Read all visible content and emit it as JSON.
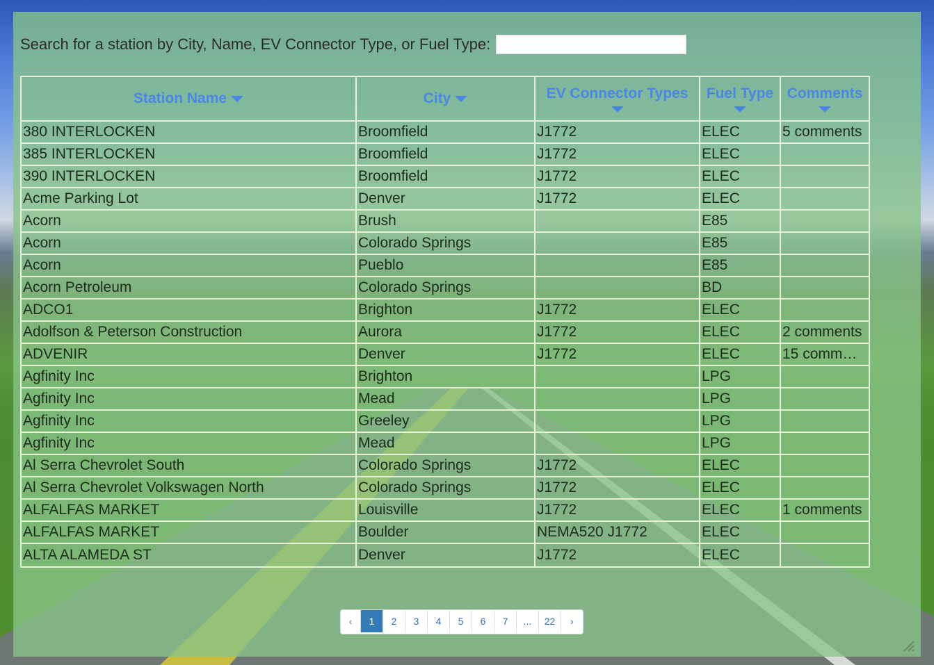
{
  "search": {
    "label": "Search for a station by City, Name, EV Connector Type, or Fuel Type:",
    "value": ""
  },
  "table": {
    "headers": [
      "Station Name",
      "City",
      "EV Connector Types",
      "Fuel Type",
      "Comments"
    ],
    "rows": [
      [
        "380 INTERLOCKEN",
        "Broomfield",
        "J1772",
        "ELEC",
        "5 comments"
      ],
      [
        "385 INTERLOCKEN",
        "Broomfield",
        "J1772",
        "ELEC",
        ""
      ],
      [
        "390 INTERLOCKEN",
        "Broomfield",
        "J1772",
        "ELEC",
        ""
      ],
      [
        "Acme Parking Lot",
        "Denver",
        "J1772",
        "ELEC",
        ""
      ],
      [
        "Acorn",
        "Brush",
        "",
        "E85",
        ""
      ],
      [
        "Acorn",
        "Colorado Springs",
        "",
        "E85",
        ""
      ],
      [
        "Acorn",
        "Pueblo",
        "",
        "E85",
        ""
      ],
      [
        "Acorn Petroleum",
        "Colorado Springs",
        "",
        "BD",
        ""
      ],
      [
        "ADCO1",
        "Brighton",
        "J1772",
        "ELEC",
        ""
      ],
      [
        "Adolfson & Peterson Construction",
        "Aurora",
        "J1772",
        "ELEC",
        "2 comments"
      ],
      [
        "ADVENIR",
        "Denver",
        "J1772",
        "ELEC",
        "15 comm…"
      ],
      [
        "Agfinity Inc",
        "Brighton",
        "",
        "LPG",
        ""
      ],
      [
        "Agfinity Inc",
        "Mead",
        "",
        "LPG",
        ""
      ],
      [
        "Agfinity Inc",
        "Greeley",
        "",
        "LPG",
        ""
      ],
      [
        "Agfinity Inc",
        "Mead",
        "",
        "LPG",
        ""
      ],
      [
        "Al Serra Chevrolet South",
        "Colorado Springs",
        "J1772",
        "ELEC",
        ""
      ],
      [
        "Al Serra Chevrolet Volkswagen North",
        "Colorado Springs",
        "J1772",
        "ELEC",
        ""
      ],
      [
        "ALFALFAS MARKET",
        "Louisville",
        "J1772",
        "ELEC",
        "1 comments"
      ],
      [
        "ALFALFAS MARKET",
        "Boulder",
        "NEMA520 J1772",
        "ELEC",
        ""
      ],
      [
        "ALTA ALAMEDA ST",
        "Denver",
        "J1772",
        "ELEC",
        ""
      ]
    ]
  },
  "pagination": {
    "prev": "‹",
    "pages": [
      "1",
      "2",
      "3",
      "4",
      "5",
      "6",
      "7",
      "...",
      "22"
    ],
    "next": "›",
    "current": "1"
  },
  "icons": {
    "sort": "caret-down-icon",
    "resize": "resize-handle-icon"
  },
  "colors": {
    "header_text": "#4a86e8",
    "active_page": "#337ab7",
    "panel": "#88c488"
  }
}
